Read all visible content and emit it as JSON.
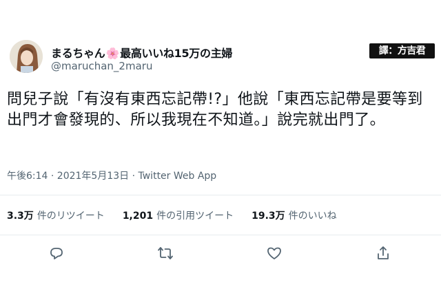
{
  "tweet": {
    "author": {
      "name_prefix": "まるちゃん",
      "name_flower": "🌸",
      "name_suffix": "最高いいね15万の主婦",
      "handle": "@maruchan_2maru"
    },
    "credit_label": "譯：方吉君",
    "text": "問兒子說「有沒有東西忘記帶!?」他說「東西忘記帶是要等到出門才會發現的、所以我現在不知道。」說完就出門了。",
    "timestamp": "午後6:14 · 2021年5月13日",
    "separator": " · ",
    "client": "Twitter Web App",
    "stats": {
      "retweets_value": "3.3万",
      "retweets_label": "件のリツイート",
      "quotes_value": "1,201",
      "quotes_label": "件の引用ツイート",
      "likes_value": "19.3万",
      "likes_label": "件のいいね"
    },
    "actions": {
      "reply_icon": "reply-icon",
      "retweet_icon": "retweet-icon",
      "like_icon": "heart-icon",
      "share_icon": "share-icon"
    }
  },
  "colors": {
    "text": "#0f1419",
    "secondary": "#536471",
    "divider": "#e6ebee",
    "credit_bg": "#111111"
  }
}
